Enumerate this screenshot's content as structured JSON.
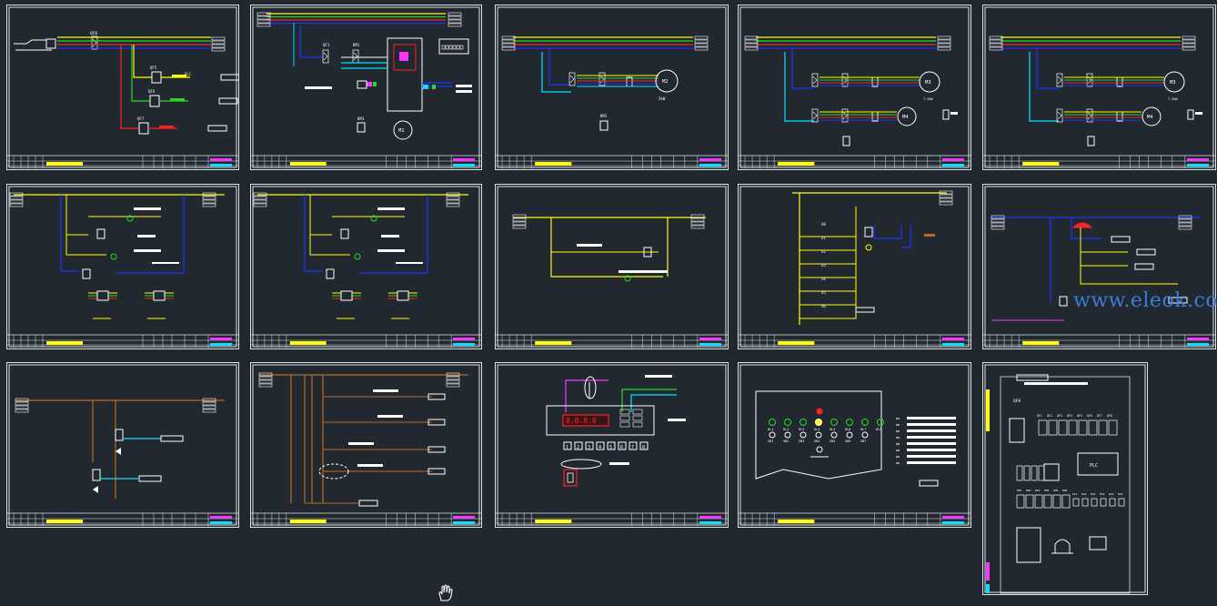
{
  "canvas": {
    "background": "#212830",
    "sheet_count": 15
  },
  "colors": {
    "frame": "#dfe3e8",
    "yellow": "#ffff00",
    "green": "#22dd22",
    "blue": "#1a34ff",
    "cyan": "#00e6ff",
    "red": "#ff2222",
    "magenta": "#ff33ff",
    "brown": "#b86a22",
    "white": "#ffffff"
  },
  "watermark": "www.eleok.com",
  "sheets": [
    {
      "id": "power-main",
      "kind": "power-main",
      "labels": [
        "QF0",
        "QF5",
        "QF6",
        "QF7",
        "PLC"
      ]
    },
    {
      "id": "inverter-m1",
      "kind": "inverter",
      "labels": [
        "QF1",
        "KM1",
        "KM2",
        "M1",
        "KM3"
      ]
    },
    {
      "id": "motor-m2",
      "kind": "motor1",
      "labels": [
        "QF2",
        "KM3",
        "M2",
        "KM3"
      ]
    },
    {
      "id": "motor-m3-m4",
      "kind": "motor2",
      "labels": [
        "QF3",
        "KM4",
        "M3",
        "QF4",
        "KM5",
        "M4",
        "KM5"
      ]
    },
    {
      "id": "motor-m5-m6",
      "kind": "motor2",
      "labels": [
        "QF5",
        "KM6",
        "M5",
        "QF6",
        "KM7",
        "M6",
        "KM7"
      ]
    },
    {
      "id": "ctrl-1",
      "kind": "ctrl-a",
      "labels": [
        "KA1",
        "KM1",
        "KA2",
        "KM2",
        "KM1",
        "KM2"
      ]
    },
    {
      "id": "ctrl-2",
      "kind": "ctrl-a",
      "labels": [
        "KA3",
        "KM3",
        "KA4",
        "KM4",
        "KM3",
        "KM4"
      ]
    },
    {
      "id": "ctrl-3",
      "kind": "ctrl-b",
      "labels": [
        "SB1",
        "KA7",
        "KM7",
        "KM7"
      ]
    },
    {
      "id": "plc-inputs",
      "kind": "plc-in",
      "labels": [
        "X0",
        "X1",
        "X2",
        "X3",
        "X4",
        "X5",
        "X6",
        "KA8"
      ]
    },
    {
      "id": "alarm",
      "kind": "alarm",
      "labels": [
        "HA",
        "KA9",
        "KA10",
        "KA11"
      ]
    },
    {
      "id": "valves",
      "kind": "valve",
      "labels": [
        "YV1",
        "YV2"
      ]
    },
    {
      "id": "relays",
      "kind": "relay",
      "labels": [
        "KA1",
        "KA2",
        "KA3",
        "KA4"
      ]
    },
    {
      "id": "instrument",
      "kind": "meter",
      "labels": [
        "8.8.8.8",
        "1",
        "2",
        "3",
        "4",
        "5",
        "6",
        "7",
        "8"
      ]
    },
    {
      "id": "panel-door",
      "kind": "door",
      "labels": [
        "HL1",
        "HL2",
        "HL3",
        "HL4",
        "HL5",
        "HL6",
        "HL7",
        "HL8",
        "SB1",
        "SB2",
        "SB3",
        "SB4",
        "SB5",
        "SB6",
        "SB7"
      ]
    },
    {
      "id": "panel-layout",
      "kind": "layout",
      "labels": [
        "QF0",
        "PLC",
        "QF1",
        "QF2",
        "QF3",
        "QF4",
        "QF5",
        "QF6",
        "QF7",
        "QF8",
        "KM1",
        "KM2",
        "KM3",
        "KM4",
        "KM5",
        "KM6",
        "KA1",
        "KA2",
        "KA3",
        "KA4",
        "KA5",
        "KA6"
      ]
    }
  ]
}
